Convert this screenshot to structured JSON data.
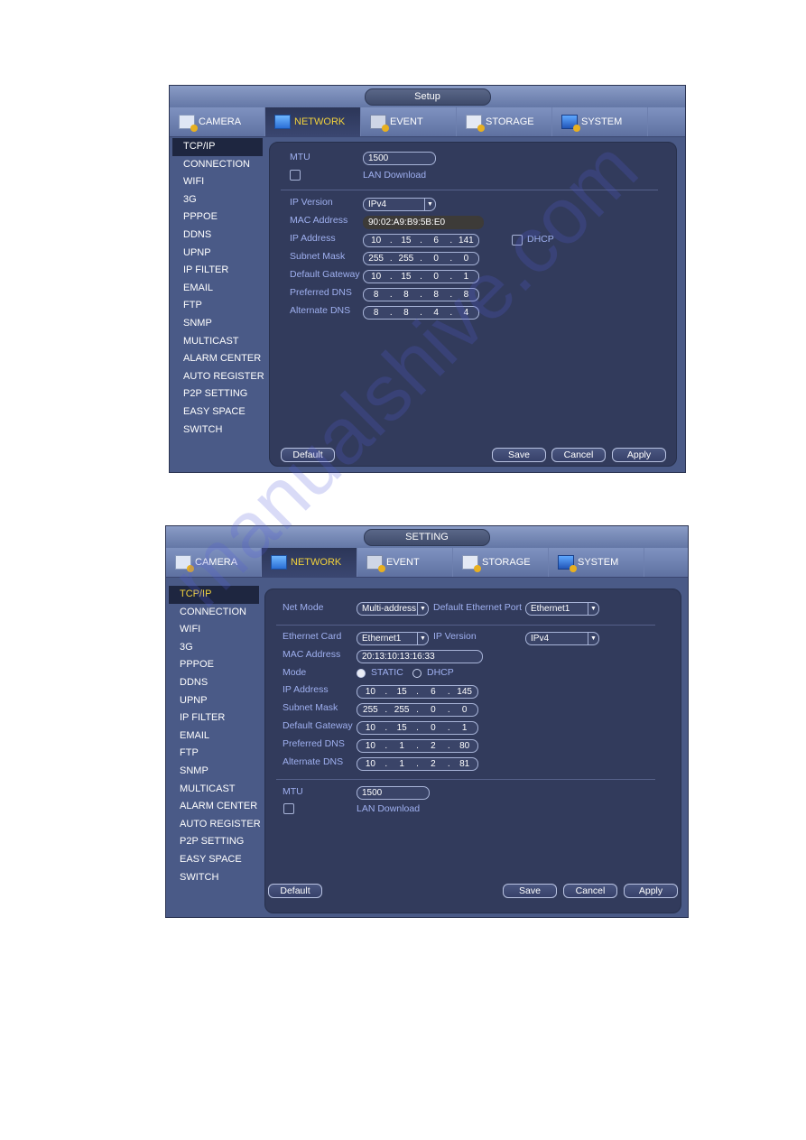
{
  "screenshot1": {
    "title": "Setup",
    "tabs": [
      {
        "label": "CAMERA",
        "icon": "camera-icon"
      },
      {
        "label": "NETWORK",
        "icon": "network-icon",
        "active": true
      },
      {
        "label": "EVENT",
        "icon": "event-icon"
      },
      {
        "label": "STORAGE",
        "icon": "storage-icon"
      },
      {
        "label": "SYSTEM",
        "icon": "system-icon"
      }
    ],
    "sidebar": [
      "TCP/IP",
      "CONNECTION",
      "WIFI",
      "3G",
      "PPPOE",
      "DDNS",
      "UPNP",
      "IP FILTER",
      "EMAIL",
      "FTP",
      "SNMP",
      "MULTICAST",
      "ALARM CENTER",
      "AUTO REGISTER",
      "P2P SETTING",
      "EASY SPACE",
      "SWITCH"
    ],
    "sidebar_active": "TCP/IP",
    "form": {
      "mtu_label": "MTU",
      "mtu_value": "1500",
      "lan_download_label": "LAN Download",
      "lan_download_checked": false,
      "ip_version_label": "IP Version",
      "ip_version_value": "IPv4",
      "mac_label": "MAC Address",
      "mac_value": "90:02:A9:B9:5B:E0",
      "ip_label": "IP Address",
      "ip": [
        "10",
        "15",
        "6",
        "141"
      ],
      "dhcp_label": "DHCP",
      "dhcp_checked": false,
      "subnet_label": "Subnet Mask",
      "subnet": [
        "255",
        "255",
        "0",
        "0"
      ],
      "gateway_label": "Default Gateway",
      "gateway": [
        "10",
        "15",
        "0",
        "1"
      ],
      "pdns_label": "Preferred DNS",
      "pdns": [
        "8",
        "8",
        "8",
        "8"
      ],
      "adns_label": "Alternate DNS",
      "adns": [
        "8",
        "8",
        "4",
        "4"
      ]
    },
    "buttons": {
      "default": "Default",
      "save": "Save",
      "cancel": "Cancel",
      "apply": "Apply"
    }
  },
  "screenshot2": {
    "title": "SETTING",
    "tabs": [
      {
        "label": "CAMERA",
        "icon": "camera-icon"
      },
      {
        "label": "NETWORK",
        "icon": "network-icon",
        "active": true
      },
      {
        "label": "EVENT",
        "icon": "event-icon"
      },
      {
        "label": "STORAGE",
        "icon": "storage-icon"
      },
      {
        "label": "SYSTEM",
        "icon": "system-icon"
      }
    ],
    "sidebar": [
      "TCP/IP",
      "CONNECTION",
      "WIFI",
      "3G",
      "PPPOE",
      "DDNS",
      "UPNP",
      "IP FILTER",
      "EMAIL",
      "FTP",
      "SNMP",
      "MULTICAST",
      "ALARM CENTER",
      "AUTO REGISTER",
      "P2P SETTING",
      "EASY SPACE",
      "SWITCH"
    ],
    "sidebar_active": "TCP/IP",
    "form": {
      "net_mode_label": "Net Mode",
      "net_mode_value": "Multi-address",
      "default_eth_label": "Default Ethernet Port",
      "default_eth_value": "Ethernet1",
      "eth_card_label": "Ethernet Card",
      "eth_card_value": "Ethernet1",
      "ip_version_label": "IP Version",
      "ip_version_value": "IPv4",
      "mac_label": "MAC Address",
      "mac_value": "20:13:10:13:16:33",
      "mode_label": "Mode",
      "mode_static": "STATIC",
      "mode_dhcp": "DHCP",
      "mode_selected": "STATIC",
      "ip_label": "IP Address",
      "ip": [
        "10",
        "15",
        "6",
        "145"
      ],
      "subnet_label": "Subnet Mask",
      "subnet": [
        "255",
        "255",
        "0",
        "0"
      ],
      "gateway_label": "Default Gateway",
      "gateway": [
        "10",
        "15",
        "0",
        "1"
      ],
      "pdns_label": "Preferred DNS",
      "pdns": [
        "10",
        "1",
        "2",
        "80"
      ],
      "adns_label": "Alternate DNS",
      "adns": [
        "10",
        "1",
        "2",
        "81"
      ],
      "mtu_label": "MTU",
      "mtu_value": "1500",
      "lan_download_label": "LAN Download",
      "lan_download_checked": false
    },
    "buttons": {
      "default": "Default",
      "save": "Save",
      "cancel": "Cancel",
      "apply": "Apply"
    }
  },
  "watermark": "manualshive.com"
}
